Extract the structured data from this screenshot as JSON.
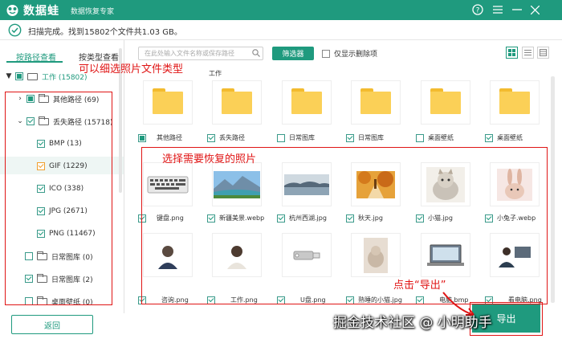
{
  "app": {
    "name": "数据蛙",
    "subtitle": "数据恢复专家"
  },
  "status": {
    "text": "扫描完成。找到15802个文件共1.03 GB。"
  },
  "tabs": {
    "by_path": "按路径查看",
    "by_type": "按类型查看"
  },
  "tree": {
    "root": "工作 (15802)",
    "other_paths": "其他路径 (69)",
    "lost_paths": "丢失路径 (15718)",
    "bmp": "BMP (13)",
    "gif": "GIF (1229)",
    "ico": "ICO (338)",
    "jpg": "JPG (2671)",
    "png": "PNG (11467)",
    "daily_lib_1": "日常图库 (0)",
    "daily_lib_2": "日常图库 (2)",
    "desktop_wall": "桌面壁纸 (0)"
  },
  "toolbar": {
    "search_placeholder": "在此处输入文件名称或保存路径",
    "filter": "筛选器",
    "only_deleted": "仅显示删除项"
  },
  "breadcrumb": "工作",
  "folders": [
    {
      "label": "其他路径",
      "checked": "partial"
    },
    {
      "label": "丢失路径",
      "checked": "checked"
    },
    {
      "label": "日常图库",
      "checked": "none"
    },
    {
      "label": "日常图库",
      "checked": "checked"
    },
    {
      "label": "桌面壁纸",
      "checked": "none"
    },
    {
      "label": "桌面壁纸",
      "checked": "checked"
    }
  ],
  "files_row1": [
    {
      "label": "键盘.png"
    },
    {
      "label": "新疆美景.webp"
    },
    {
      "label": "杭州西湖.jpg"
    },
    {
      "label": "秋天.jpg"
    },
    {
      "label": "小猫.jpg"
    },
    {
      "label": "小兔子.webp"
    }
  ],
  "files_row2": [
    {
      "label": "咨询.png"
    },
    {
      "label": "工作.png"
    },
    {
      "label": "U盘.png"
    },
    {
      "label": "熟睡的小猫.jpg"
    },
    {
      "label": "电脑.bmp"
    },
    {
      "label": "看电脑.png"
    }
  ],
  "buttons": {
    "back": "返回",
    "export": "导出"
  },
  "annotations": {
    "filter_hint": "可以细选照片文件类型",
    "select_hint": "选择需要恢复的照片",
    "export_hint": "点击“导出”"
  },
  "watermark": "掘金技术社区 @ 小明助手",
  "colors": {
    "brand": "#1f9a7e",
    "annotation": "#e01515"
  }
}
